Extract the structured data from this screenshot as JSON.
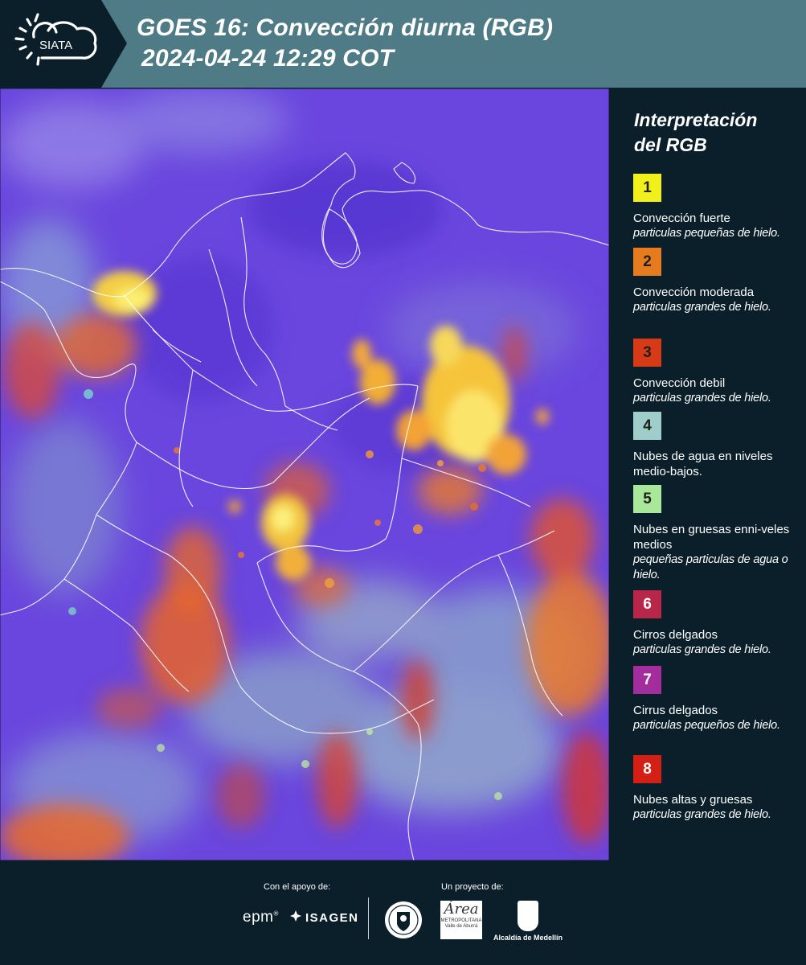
{
  "header": {
    "logo_text": "SIATA",
    "title_line1": "GOES 16: Convección diurna (RGB)",
    "title_line2": "2024-04-24 12:29 COT"
  },
  "legend": {
    "title_line1": "Interpretación",
    "title_line2": "del RGB",
    "items": [
      {
        "number": "1",
        "color": "#f2f01a",
        "label": "Convección fuerte",
        "desc": "particulas pequeñas de hielo."
      },
      {
        "number": "2",
        "color": "#e57b1c",
        "label": "Convección moderada",
        "desc": "particulas grandes de hielo."
      },
      {
        "number": "3",
        "color": "#d73a17",
        "label": "Convección debil",
        "desc": "particulas grandes de hielo."
      },
      {
        "number": "4",
        "color": "#9fcdc9",
        "label": "Nubes de agua en niveles medio-bajos.",
        "desc": ""
      },
      {
        "number": "5",
        "color": "#a9e89a",
        "label": "Nubes en gruesas enni-veles medios",
        "desc": "pequeñas particulas de agua o hielo."
      },
      {
        "number": "6",
        "color": "#b8274a",
        "label": "Cirros delgados",
        "desc": "particulas grandes de hielo."
      },
      {
        "number": "7",
        "color": "#a42d9e",
        "label": "Cirrus delgados",
        "desc": "particulas pequeños de hielo."
      },
      {
        "number": "8",
        "color": "#d41f14",
        "label": "Nubes altas y gruesas",
        "desc": "particulas grandes de hielo."
      }
    ]
  },
  "footer": {
    "support_label": "Con el apoyo de:",
    "project_label": "Un proyecto de:",
    "sponsor_1": "epm",
    "sponsor_2": "ISAGEN",
    "partner_area": "Área",
    "partner_area_sub": "METROPOLITANA Valle de Aburrá",
    "partner_alcaldia": "Alcaldía de Medellín"
  },
  "colors": {
    "header_bg": "#4e7b86",
    "panel_bg": "#0b1f2a",
    "map_base": "#6a44e0"
  }
}
